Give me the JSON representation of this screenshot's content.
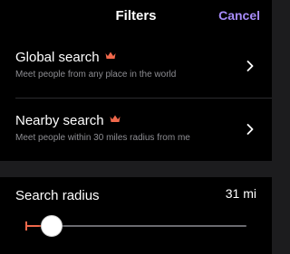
{
  "header": {
    "title": "Filters",
    "cancel_label": "Cancel"
  },
  "options": [
    {
      "title": "Global search",
      "subtitle": "Meet people from any place in the world",
      "icon": "crown-icon"
    },
    {
      "title": "Nearby search",
      "subtitle": "Meet people within 30 miles radius from me",
      "icon": "crown-icon"
    }
  ],
  "radius": {
    "label": "Search radius",
    "value_text": "31 mi"
  },
  "colors": {
    "accent": "#a78bfa",
    "crown": "#f0684b",
    "slider_min": "#f0684b"
  }
}
